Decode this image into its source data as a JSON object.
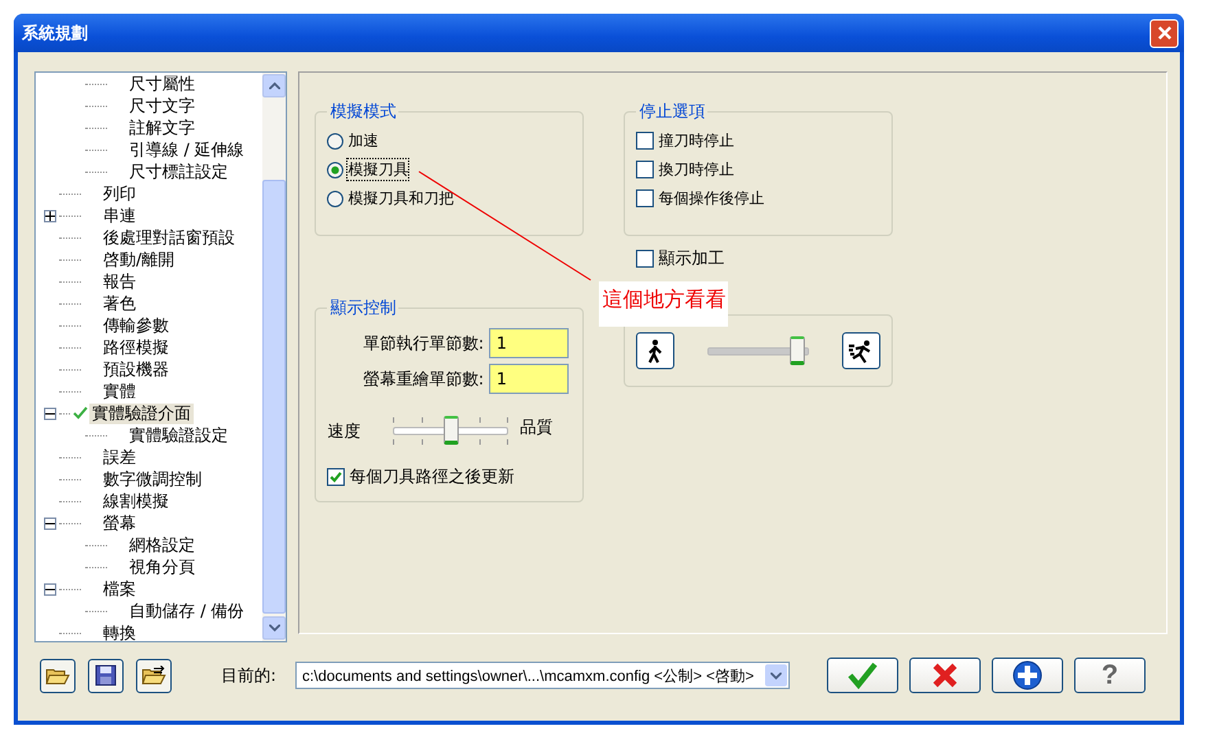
{
  "window": {
    "title": "系統規劃"
  },
  "tree": {
    "continued": [
      {
        "label": "尺寸屬性",
        "selected": false
      },
      {
        "label": "尺寸文字",
        "selected": false
      },
      {
        "label": "註解文字",
        "selected": false
      },
      {
        "label": "引導線 / 延伸線",
        "selected": false
      },
      {
        "label": "尺寸標註設定",
        "selected": false
      }
    ],
    "items": [
      {
        "label": "列印",
        "selected": false,
        "checked": false
      },
      {
        "label": "串連",
        "selected": false,
        "checked": false,
        "expanded": false
      },
      {
        "label": "後處理對話窗預設",
        "selected": false,
        "checked": false
      },
      {
        "label": "啓動/離開",
        "selected": false,
        "checked": false
      },
      {
        "label": "報告",
        "selected": false,
        "checked": false
      },
      {
        "label": "著色",
        "selected": false,
        "checked": false
      },
      {
        "label": "傳輸參數",
        "selected": false,
        "checked": false
      },
      {
        "label": "路徑模擬",
        "selected": false,
        "checked": false
      },
      {
        "label": "預設機器",
        "selected": false,
        "checked": false
      },
      {
        "label": "實體",
        "selected": false,
        "checked": false
      },
      {
        "label": "實體驗證介面",
        "selected": true,
        "checked": true,
        "expanded": true,
        "children": [
          {
            "label": "實體驗證設定",
            "selected": false,
            "checked": false
          }
        ]
      },
      {
        "label": "誤差",
        "selected": false,
        "checked": false
      },
      {
        "label": "數字微調控制",
        "selected": false,
        "checked": false
      },
      {
        "label": "線割模擬",
        "selected": false,
        "checked": false
      },
      {
        "label": "螢幕",
        "selected": false,
        "checked": false,
        "expanded": true,
        "children": [
          {
            "label": "網格設定",
            "selected": false,
            "checked": false
          },
          {
            "label": "視角分頁",
            "selected": false,
            "checked": false
          }
        ]
      },
      {
        "label": "檔案",
        "selected": false,
        "checked": false,
        "expanded": true,
        "children": [
          {
            "label": "自動儲存 / 備份",
            "selected": false,
            "checked": false
          }
        ]
      },
      {
        "label": "轉換",
        "selected": false,
        "checked": false
      }
    ]
  },
  "sim_mode": {
    "title": "模擬模式",
    "options": [
      {
        "label": "加速",
        "selected": false
      },
      {
        "label": "模擬刀具",
        "selected": true
      },
      {
        "label": "模擬刀具和刀把",
        "selected": false
      }
    ]
  },
  "stop_options": {
    "title": "停止選項",
    "options": [
      {
        "label": "撞刀時停止",
        "checked": false
      },
      {
        "label": "換刀時停止",
        "checked": false
      },
      {
        "label": "每個操作後停止",
        "checked": false
      }
    ]
  },
  "show_machining": {
    "label": "顯示加工",
    "checked": false
  },
  "display_control": {
    "title": "顯示控制",
    "fields": [
      {
        "label": "單節執行單節數:",
        "value": "1"
      },
      {
        "label": "螢幕重繪單節數:",
        "value": "1"
      }
    ],
    "slider": {
      "left_label": "速度",
      "right_label": "品質",
      "level": 0.5
    },
    "update": {
      "label": "每個刀具路徑之後更新",
      "checked": true
    }
  },
  "speed": {
    "level": 1
  },
  "annotation": {
    "text": "這個地方看看"
  },
  "current": {
    "label": "目前的:",
    "value": "c:\\documents and settings\\owner\\...\\mcamxm.config <公制> <啓動>"
  },
  "buttons": [
    {
      "kind": "ok"
    },
    {
      "kind": "cancel"
    },
    {
      "kind": "add"
    },
    {
      "kind": "help",
      "label": "?"
    }
  ]
}
